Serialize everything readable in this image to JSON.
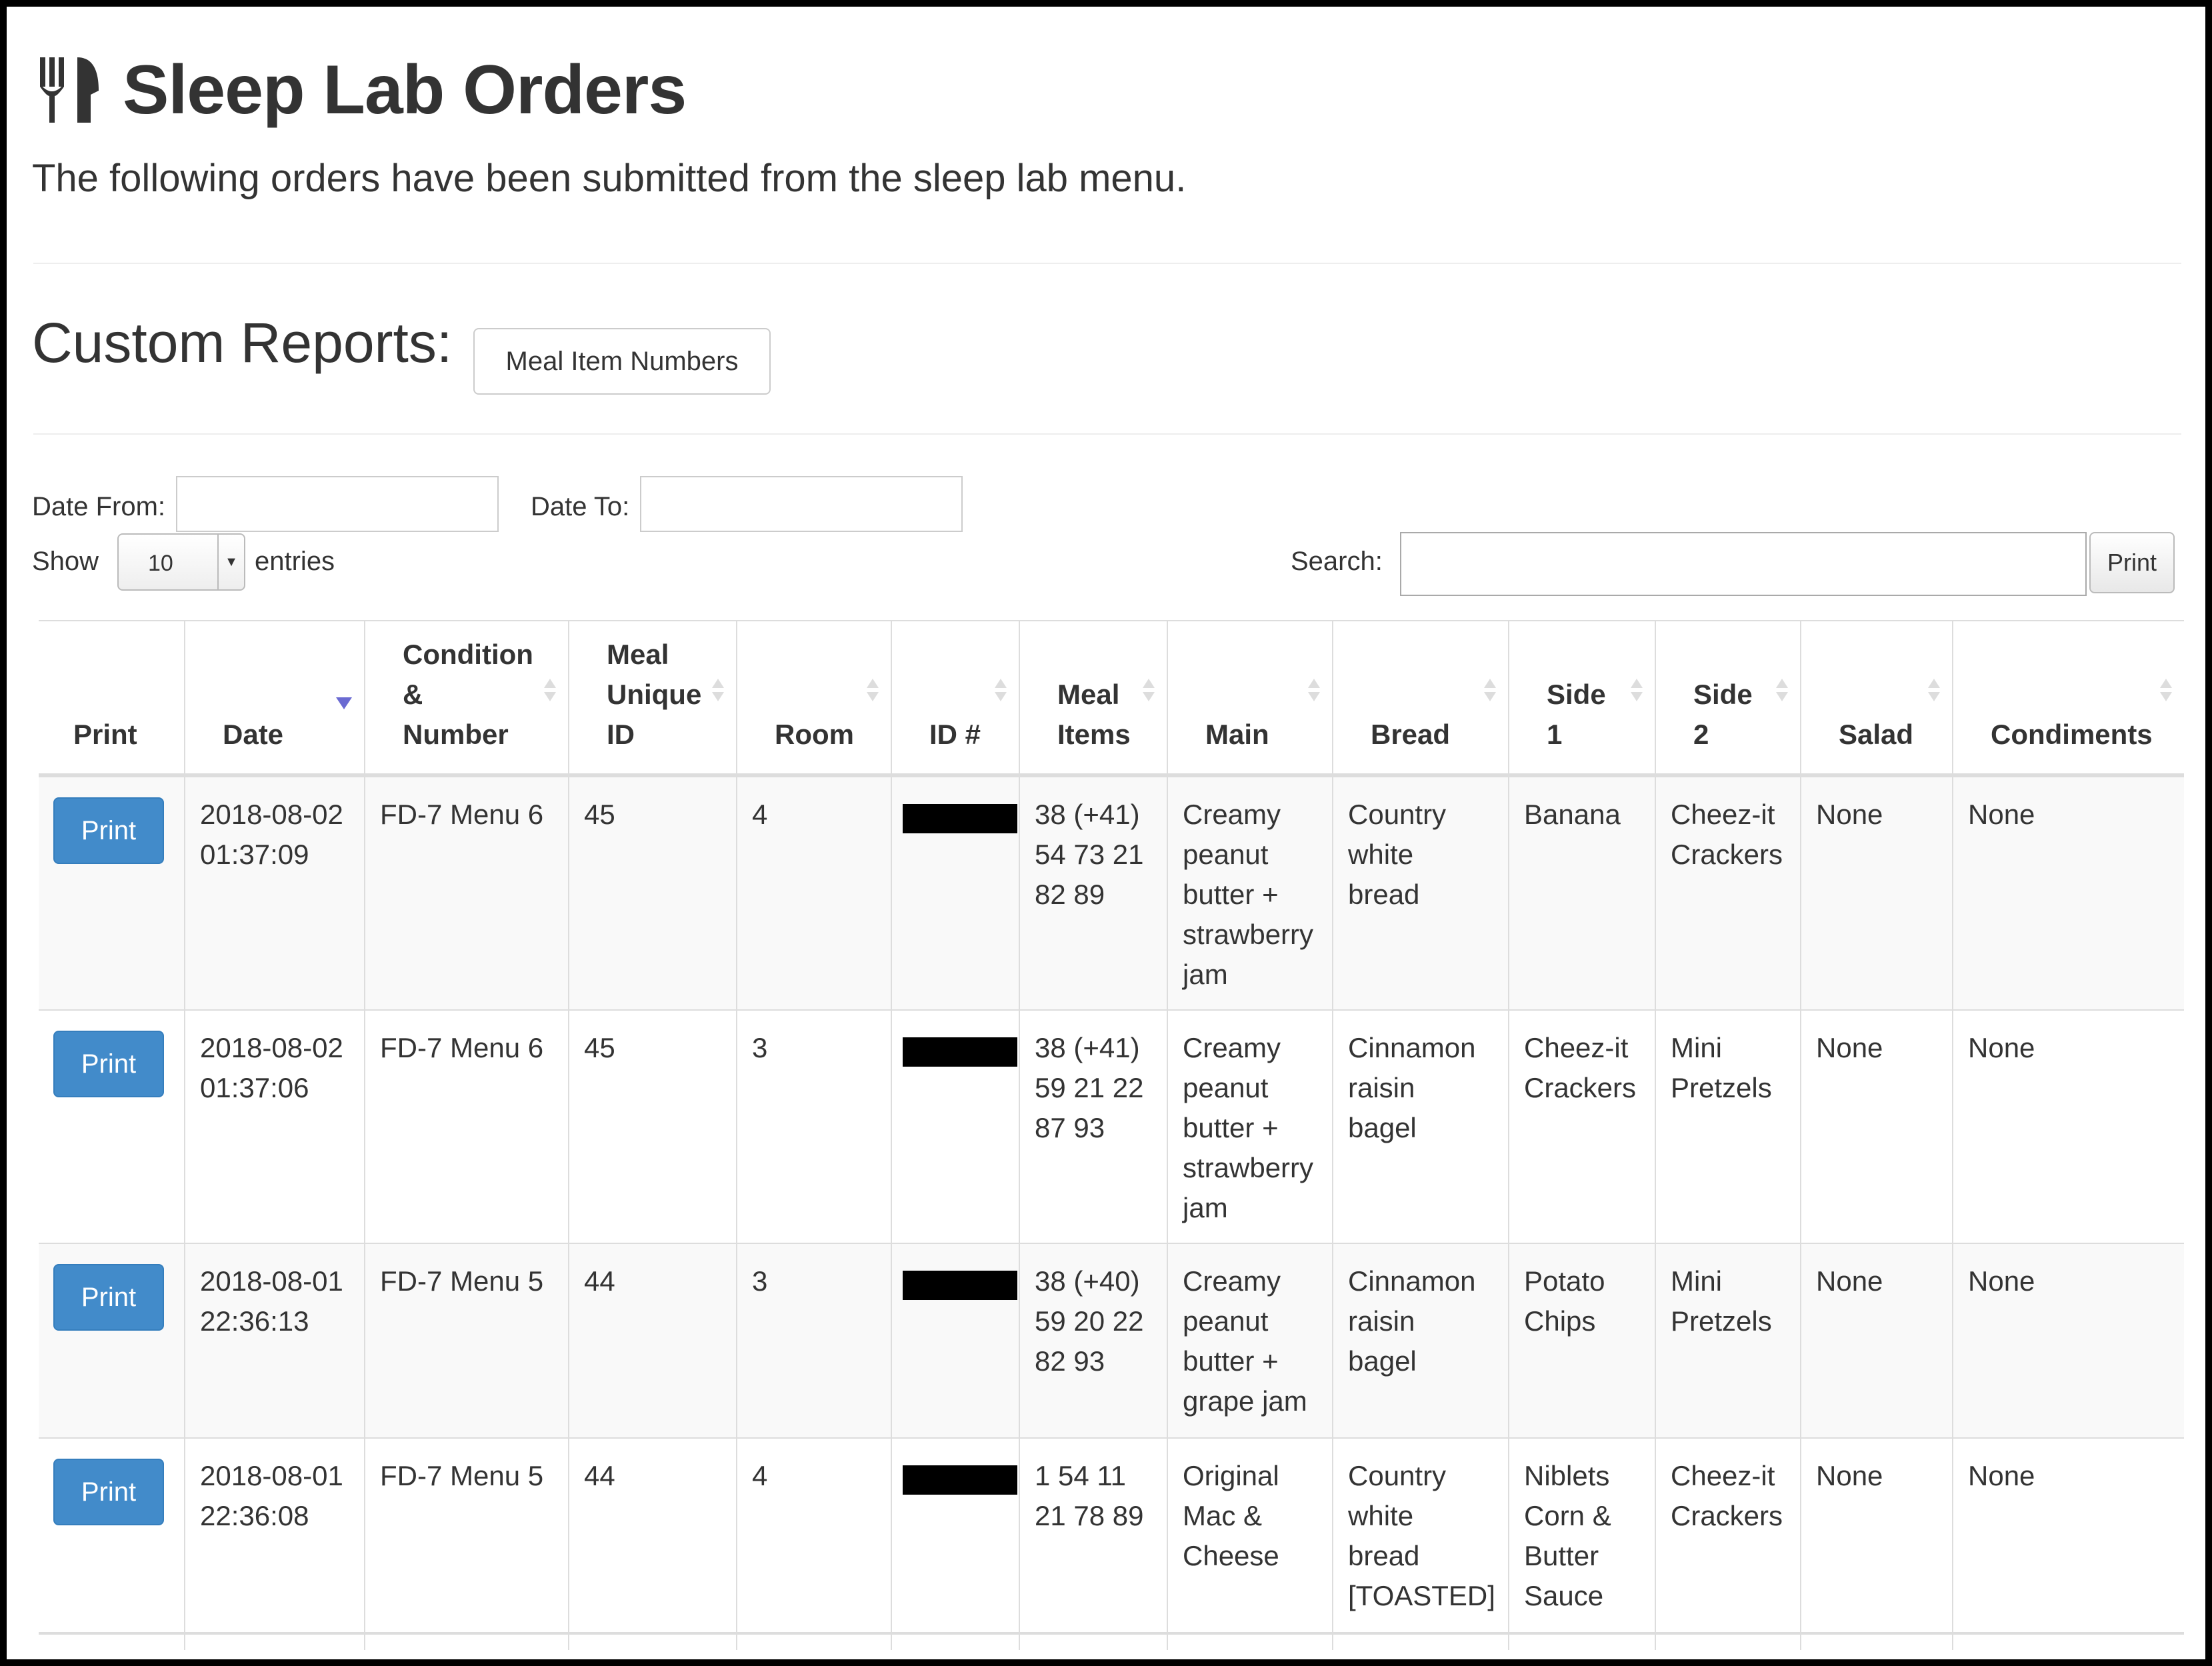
{
  "header": {
    "icon": "cutlery-icon",
    "title": "Sleep Lab Orders",
    "subtitle": "The following orders have been submitted from the sleep lab menu."
  },
  "custom_reports": {
    "label": "Custom Reports:",
    "buttons": [
      {
        "label": "Meal Item Numbers"
      }
    ]
  },
  "filters": {
    "date_from_label": "Date From:",
    "date_from_value": "",
    "date_to_label": "Date To:",
    "date_to_value": ""
  },
  "length_control": {
    "show_label": "Show",
    "selected": "10",
    "entries_label": "entries"
  },
  "search": {
    "label": "Search:",
    "value": "",
    "print_label": "Print"
  },
  "table": {
    "sorted_column": "Date",
    "sort_direction": "desc",
    "columns": [
      {
        "key": "print",
        "label": "Print",
        "sortable": false
      },
      {
        "key": "date",
        "label": "Date",
        "sortable": true
      },
      {
        "key": "condition",
        "label": "Condition\n&\nNumber",
        "sortable": true
      },
      {
        "key": "meal_uid",
        "label": "Meal\nUnique\nID",
        "sortable": true
      },
      {
        "key": "room",
        "label": "Room",
        "sortable": true
      },
      {
        "key": "id_num",
        "label": "ID #",
        "sortable": true
      },
      {
        "key": "meal_items",
        "label": "Meal\nItems",
        "sortable": true
      },
      {
        "key": "main",
        "label": "Main",
        "sortable": true
      },
      {
        "key": "bread",
        "label": "Bread",
        "sortable": true
      },
      {
        "key": "side1",
        "label": "Side\n1",
        "sortable": true
      },
      {
        "key": "side2",
        "label": "Side\n2",
        "sortable": true
      },
      {
        "key": "salad",
        "label": "Salad",
        "sortable": true
      },
      {
        "key": "condiments",
        "label": "Condiments",
        "sortable": true
      }
    ],
    "rows": [
      {
        "print": "Print",
        "date": "2018-08-02\n01:37:09",
        "condition": "FD-7 Menu 6",
        "meal_uid": "45",
        "room": "4",
        "id_num": "[redacted]",
        "meal_items": "38 (+41)\n54 73 21\n82 89",
        "main": "Creamy\npeanut\nbutter +\nstrawberry\njam",
        "bread": "Country\nwhite\nbread",
        "side1": "Banana",
        "side2": "Cheez-it\nCrackers",
        "salad": "None",
        "condiments": "None"
      },
      {
        "print": "Print",
        "date": "2018-08-02\n01:37:06",
        "condition": "FD-7 Menu 6",
        "meal_uid": "45",
        "room": "3",
        "id_num": "[redacted]",
        "meal_items": "38 (+41)\n59 21 22\n87 93",
        "main": "Creamy\npeanut\nbutter +\nstrawberry\njam",
        "bread": "Cinnamon\nraisin\nbagel",
        "side1": "Cheez-it\nCrackers",
        "side2": "Mini\nPretzels",
        "salad": "None",
        "condiments": "None"
      },
      {
        "print": "Print",
        "date": "2018-08-01\n22:36:13",
        "condition": "FD-7 Menu 5",
        "meal_uid": "44",
        "room": "3",
        "id_num": "[redacted]",
        "meal_items": "38 (+40)\n59 20 22\n82 93",
        "main": "Creamy\npeanut\nbutter +\ngrape jam",
        "bread": "Cinnamon\nraisin\nbagel",
        "side1": "Potato\nChips",
        "side2": "Mini\nPretzels",
        "salad": "None",
        "condiments": "None"
      },
      {
        "print": "Print",
        "date": "2018-08-01\n22:36:08",
        "condition": "FD-7 Menu 5",
        "meal_uid": "44",
        "room": "4",
        "id_num": "[redacted]",
        "meal_items": "1 54 11\n21 78 89",
        "main": "Original\nMac &\nCheese",
        "bread": "Country\nwhite\nbread\n[TOASTED]",
        "side1": "Niblets\nCorn &\nButter\nSauce",
        "side2": "Cheez-it\nCrackers",
        "salad": "None",
        "condiments": "None"
      }
    ]
  },
  "colors": {
    "primary_button": "#428bca",
    "sort_active": "#6a6ad2",
    "stripe": "#f9f9f9",
    "border": "#dddddd"
  }
}
